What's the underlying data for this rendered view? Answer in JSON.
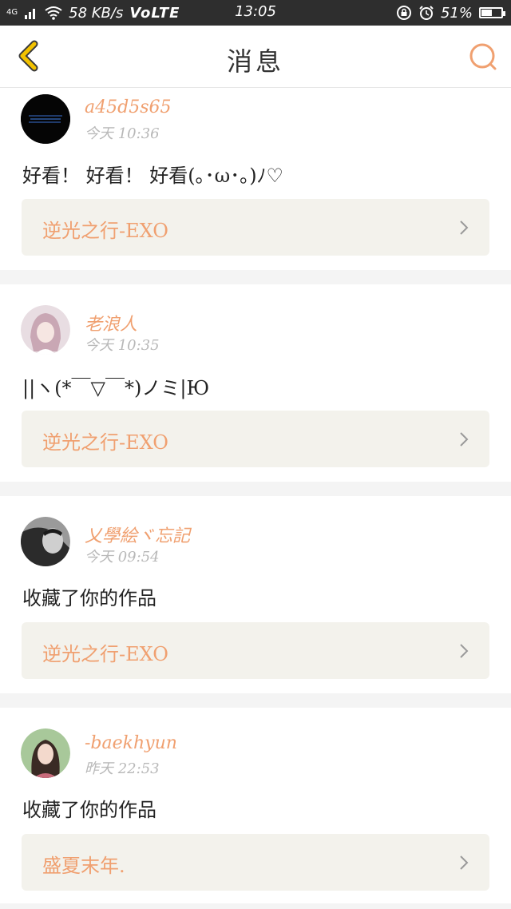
{
  "status_bar": {
    "network_badge": "4G",
    "speed": "58 KB/s",
    "volte": "VoLTE",
    "time": "13:05",
    "battery": "51%",
    "battery_level": 0.51
  },
  "header": {
    "title": "消息"
  },
  "colors": {
    "accent": "#f0a070",
    "back_icon": "#f2c200",
    "card_bg": "#ffffff",
    "link_bg": "#f3f2ec",
    "page_bg": "#f4f4f4"
  },
  "messages": [
    {
      "username": "a45d5s65",
      "time": "今天 10:36",
      "text": "好看！ 好看！ 好看(｡･ω･｡)ﾉ♡",
      "work": "逆光之行-EXO"
    },
    {
      "username": "老浪人",
      "time": "今天 10:35",
      "text": "||ヽ(*￣▽￣*)ノミ|Ю",
      "work": "逆光之行-EXO"
    },
    {
      "username": "乂學絵ヾ忘記",
      "time": "今天 09:54",
      "text": "收藏了你的作品",
      "work": "逆光之行-EXO"
    },
    {
      "username": "-baekhyun",
      "time": "昨天 22:53",
      "text": "收藏了你的作品",
      "work": "盛夏末年."
    }
  ]
}
